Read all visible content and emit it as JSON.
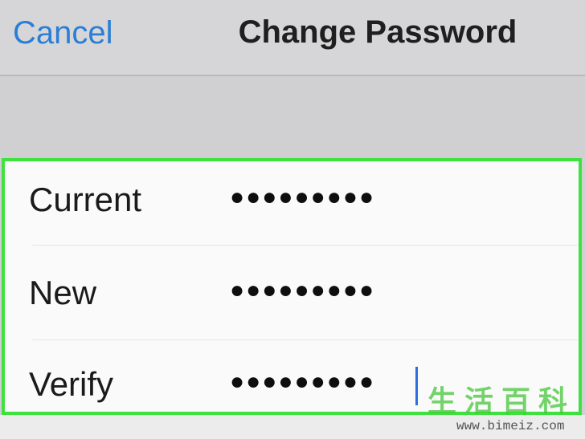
{
  "nav": {
    "cancel_label": "Cancel",
    "title": "Change Password"
  },
  "form": {
    "rows": [
      {
        "label": "Current",
        "value": "●●●●●●●●●"
      },
      {
        "label": "New",
        "value": "●●●●●●●●●"
      },
      {
        "label": "Verify",
        "value": "●●●●●●●●●"
      }
    ]
  },
  "watermark": {
    "title": "生活百科",
    "url": "www.bimeiz.com"
  },
  "colors": {
    "accent": "#2a7ed6",
    "highlight_border": "#3fe13f",
    "watermark_green": "#46c73a"
  }
}
